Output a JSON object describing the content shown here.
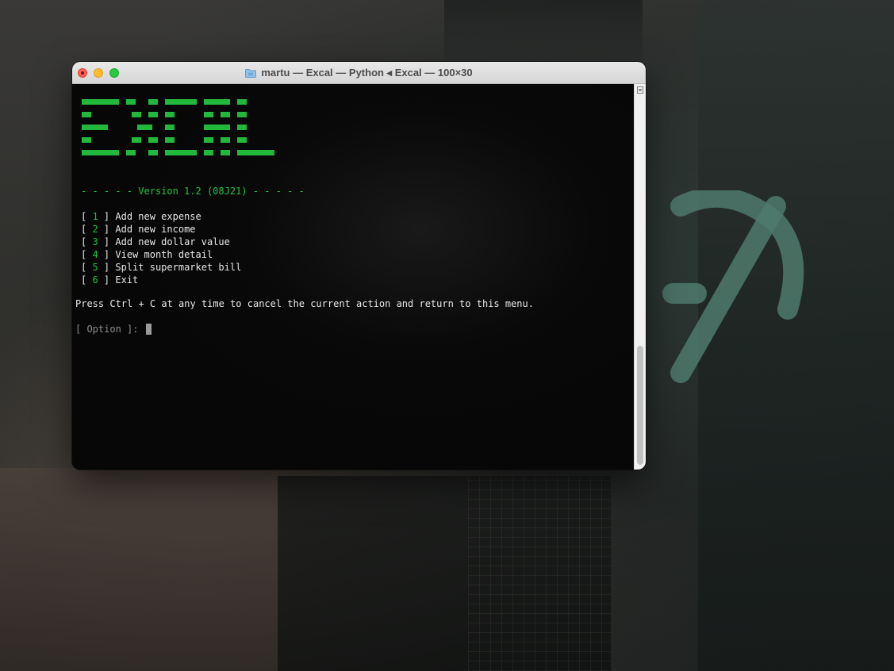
{
  "window": {
    "title": "martu — Excal — Python ◂ Excal — 100×30"
  },
  "terminal": {
    "version_line": "- - - - - Version 1.2 (08J21) - - - - -",
    "menu": [
      {
        "num": "1",
        "label": "Add new expense"
      },
      {
        "num": "2",
        "label": "Add new income"
      },
      {
        "num": "3",
        "label": "Add new dollar value"
      },
      {
        "num": "4",
        "label": "View month detail"
      },
      {
        "num": "5",
        "label": "Split supermarket bill"
      },
      {
        "num": "6",
        "label": "Exit"
      }
    ],
    "bracket_open": "[ ",
    "bracket_close": " ] ",
    "hint": "Press Ctrl + C at any time to cancel the current action and return to this menu.",
    "prompt": "[ Option ]: ",
    "banner_art": "EXCAL",
    "accent_color": "#22c043"
  },
  "icons": {
    "folder": "folder-icon",
    "scroll": "scrollbar-grip-icon"
  }
}
